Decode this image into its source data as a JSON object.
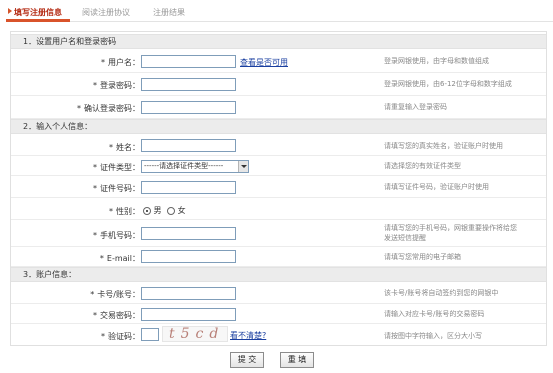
{
  "steps": [
    {
      "label": "填写注册信息",
      "active": true
    },
    {
      "label": "阅读注册协议",
      "active": false
    },
    {
      "label": "注册结果",
      "active": false
    }
  ],
  "sections": {
    "s1": "1．设置用户名和登录密码",
    "s2": "2．输入个人信息：",
    "s3": "3．账户信息："
  },
  "fields": {
    "username": {
      "label": "用户名：",
      "value": "",
      "hint": "登录网银使用，由字母和数值组成",
      "link": "查看是否可用"
    },
    "password": {
      "label": "登录密码：",
      "value": "",
      "hint": "登录网银使用，由6-12位字母和数字组成"
    },
    "confirm": {
      "label": "确认登录密码：",
      "value": "",
      "hint": "请重复输入登录密码"
    },
    "name": {
      "label": "姓名：",
      "value": "",
      "hint": "请填写您的真实姓名，验证账户时使用"
    },
    "idtype": {
      "label": "证件类型：",
      "value": "------请选择证件类型------",
      "hint": "请选择您的有效证件类型"
    },
    "idnum": {
      "label": "证件号码：",
      "value": "",
      "hint": "请填写证件号码，验证账户时使用"
    },
    "gender": {
      "label": "性别：",
      "male": "男",
      "female": "女",
      "selected": "male"
    },
    "mobile": {
      "label": "手机号码：",
      "value": "",
      "hint1": "请填写您的手机号码，网银重要操作将给您",
      "hint2": "发送短信提醒"
    },
    "email": {
      "label": "E-mail：",
      "value": "",
      "hint": "请填写您常用的电子邮箱"
    },
    "card": {
      "label": "卡号/账号：",
      "value": "",
      "hint": "该卡号/账号将自动签约到您的网银中"
    },
    "txpwd": {
      "label": "交易密码：",
      "value": "",
      "hint": "请输入对应卡号/账号的交易密码"
    },
    "code": {
      "label": "验证码：",
      "value": "",
      "captcha": "t5cd",
      "link": "看不清楚?",
      "hint": "请按图中字符输入，区分大小写"
    }
  },
  "star": "*",
  "buttons": {
    "submit": "提 交",
    "reset": "重 填"
  }
}
